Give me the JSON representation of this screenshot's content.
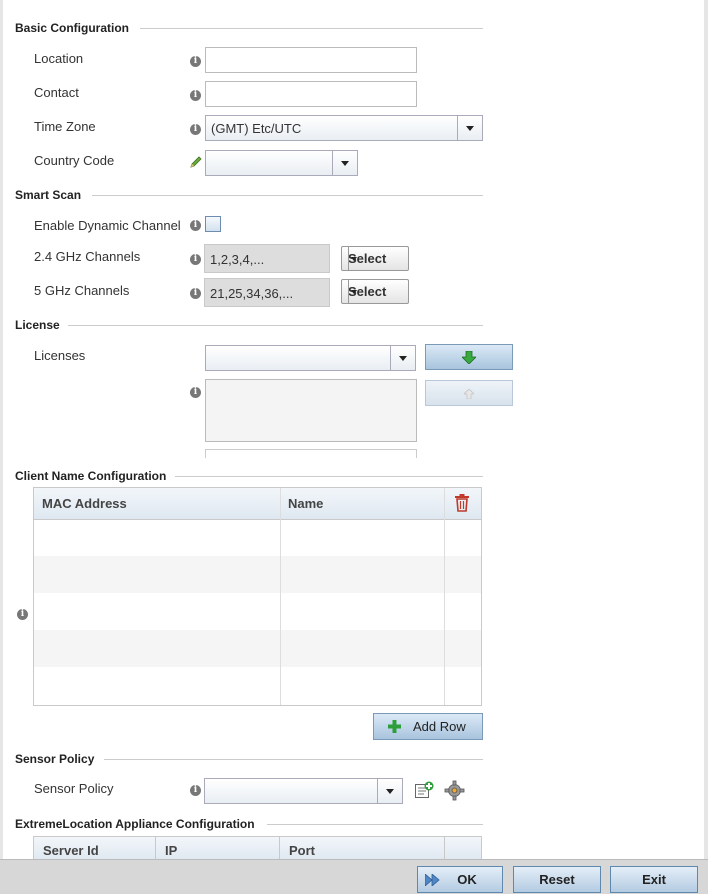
{
  "basic": {
    "title": "Basic Configuration",
    "location_label": "Location",
    "location_value": "",
    "contact_label": "Contact",
    "contact_value": "",
    "timezone_label": "Time Zone",
    "timezone_value": "(GMT) Etc/UTC",
    "country_label": "Country Code",
    "country_value": ""
  },
  "smart_scan": {
    "title": "Smart Scan",
    "dynamic_label": "Enable Dynamic Channel",
    "dynamic_checked": false,
    "ch24_label": "2.4 GHz Channels",
    "ch24_value": "1,2,3,4,...",
    "ch5_label": "5 GHz Channels",
    "ch5_value": "21,25,34,36,...",
    "select_label": "Select"
  },
  "license": {
    "title": "License",
    "licenses_label": "Licenses",
    "licenses_value": ""
  },
  "client_name": {
    "title": "Client Name Configuration",
    "columns": [
      "MAC Address",
      "Name"
    ],
    "rows": [],
    "add_row_label": "Add Row"
  },
  "sensor": {
    "title": "Sensor Policy",
    "policy_label": "Sensor Policy",
    "policy_value": ""
  },
  "extremelocation": {
    "title": "ExtremeLocation Appliance Configuration",
    "columns": [
      "Server Id",
      "IP",
      "Port"
    ]
  },
  "footer": {
    "ok_label": "OK",
    "reset_label": "Reset",
    "exit_label": "Exit"
  },
  "icons": {
    "info": "info-icon",
    "edit": "pencil-icon",
    "delete": "trash-icon",
    "add": "plus-icon",
    "move_down": "green-arrow-down-icon",
    "move_up": "arrow-up-icon",
    "create": "create-policy-icon",
    "configure": "gear-icon"
  },
  "colors": {
    "button_blue": "#b3cbe2",
    "add_green": "#2e9e3a",
    "delete_red": "#c0392b"
  }
}
